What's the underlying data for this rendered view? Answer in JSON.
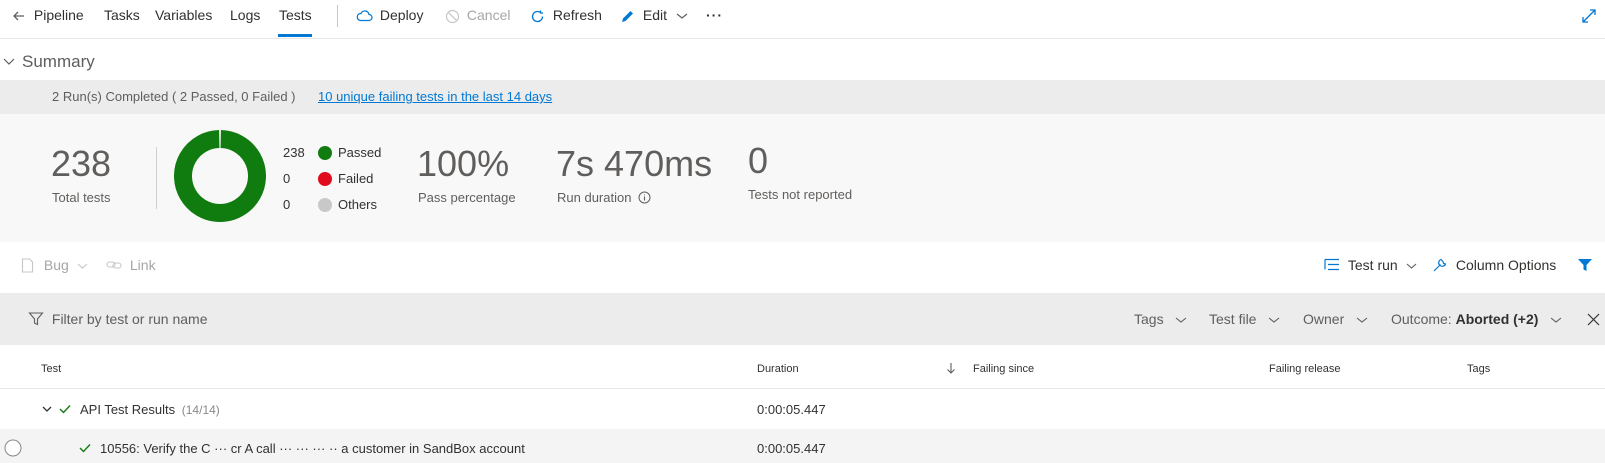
{
  "toolbar": {
    "back_label": "Pipeline",
    "tabs": [
      "Tasks",
      "Variables",
      "Logs",
      "Tests"
    ],
    "active_tab": "Tests",
    "deploy_label": "Deploy",
    "cancel_label": "Cancel",
    "refresh_label": "Refresh",
    "edit_label": "Edit",
    "more_label": "···"
  },
  "summary": {
    "title": "Summary",
    "run_status": "2 Run(s) Completed ( 2 Passed, 0 Failed )",
    "failing_link": "10 unique failing tests in the last 14 days"
  },
  "stats": {
    "total_tests": "238",
    "total_tests_label": "Total tests",
    "legend": [
      {
        "count": "238",
        "label": "Passed",
        "color": "#107c10"
      },
      {
        "count": "0",
        "label": "Failed",
        "color": "#e00b1c"
      },
      {
        "count": "0",
        "label": "Others",
        "color": "#c8c8c8"
      }
    ],
    "pass_percentage": "100%",
    "pass_percentage_label": "Pass percentage",
    "run_duration": "7s 470ms",
    "run_duration_label": "Run duration",
    "not_reported": "0",
    "not_reported_label": "Tests not reported"
  },
  "chart_data": {
    "type": "pie",
    "categories": [
      "Passed",
      "Failed",
      "Others"
    ],
    "values": [
      238,
      0,
      0
    ],
    "colors": [
      "#107c10",
      "#e00b1c",
      "#c8c8c8"
    ]
  },
  "actions": {
    "bug_label": "Bug",
    "link_label": "Link",
    "test_run_label": "Test run",
    "column_options_label": "Column Options"
  },
  "filters": {
    "search_placeholder": "Filter by test or run name",
    "tags_label": "Tags",
    "test_file_label": "Test file",
    "owner_label": "Owner",
    "outcome_label": "Outcome:",
    "outcome_value": "Aborted (+2)"
  },
  "table": {
    "columns": {
      "test": "Test",
      "duration": "Duration",
      "failing_since": "Failing since",
      "failing_release": "Failing release",
      "tags": "Tags"
    },
    "group": {
      "name": "API Test Results",
      "count": "(14/14)",
      "duration": "0:00:05.447"
    },
    "rows": [
      {
        "name": "10556: Verify the C         ··· cr   A       call ··· ··· ··· ·· a customer in SandBox account",
        "duration": "0:00:05.447"
      }
    ]
  },
  "colors": {
    "accent": "#0078d4",
    "passed": "#107c10",
    "failed": "#e00b1c",
    "others": "#c8c8c8"
  }
}
